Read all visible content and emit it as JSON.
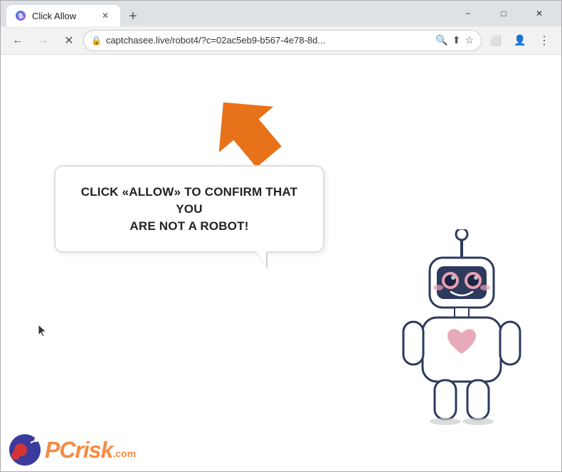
{
  "browser": {
    "tab": {
      "label": "Click Allow",
      "favicon_alt": "loading-icon"
    },
    "controls": {
      "minimize": "−",
      "maximize": "□",
      "close": "✕"
    },
    "nav": {
      "back": "←",
      "forward": "→",
      "reload": "✕"
    },
    "address": {
      "url": "captchasee.live/robot4/?c=02ac5eb9-b567-4e78-8d...",
      "protocol_icon": "🔒"
    },
    "new_tab": "+"
  },
  "page": {
    "bubble_line1": "CLICK «ALLOW» TO CONFIRM THAT YOU",
    "bubble_line2": "ARE NOT A ROBOT!",
    "watermark": {
      "brand": "PC",
      "brand2": "risk",
      "tld": ".com"
    }
  }
}
